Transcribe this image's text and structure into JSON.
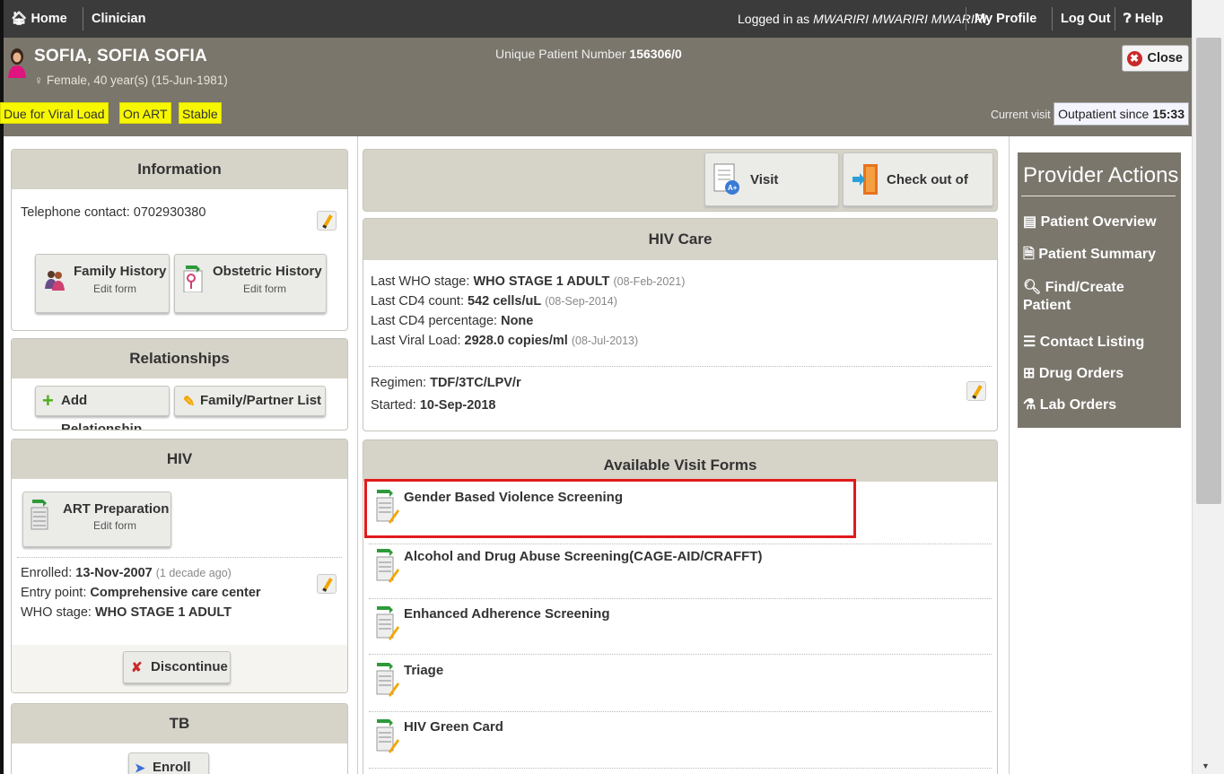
{
  "nav": {
    "home": "Home",
    "app": "Clinician",
    "logged_prefix": "Logged in as",
    "logged_user": "MWARIRI MWARIRI MWARIRI",
    "my_profile": "My Profile",
    "logout": "Log Out",
    "help": "Help"
  },
  "patient": {
    "name": "SOFIA, SOFIA SOFIA",
    "gender_age": "♀ Female, 40 year(s) (15-Jun-1981)",
    "upn_label": "Unique Patient Number",
    "upn": "156306/0",
    "flags": [
      "Due for Viral Load",
      "On ART",
      "Stable"
    ],
    "close": "Close",
    "current_visit_label": "Current visit",
    "visit_type": "Outpatient since",
    "visit_time": "15:33"
  },
  "information": {
    "title": "Information",
    "telephone": "Telephone contact: 0702930380",
    "family_history": "Family History",
    "family_history_sub": "Edit form",
    "obstetric_history": "Obstetric History",
    "obstetric_history_sub": "Edit form"
  },
  "relationships": {
    "title": "Relationships",
    "add": "Add Relationship",
    "list": "Family/Partner List"
  },
  "hiv": {
    "title": "HIV",
    "art_prep": "ART Preparation",
    "art_prep_sub": "Edit form",
    "enrolled_label": "Enrolled:",
    "enrolled": "13-Nov-2007",
    "enrolled_ago": "(1 decade ago)",
    "entry_label": "Entry point:",
    "entry": "Comprehensive care center",
    "who_label": "WHO stage:",
    "who": "WHO STAGE 1 ADULT",
    "discontinue": "Discontinue"
  },
  "tb": {
    "title": "TB",
    "enroll": "Enroll"
  },
  "toolbar": {
    "visit_summary": "Visit Summary",
    "check_out": "Check out of visit"
  },
  "hiv_care": {
    "title": "HIV Care",
    "who_label": "Last WHO stage:",
    "who": "WHO STAGE 1 ADULT",
    "who_date": "(08-Feb-2021)",
    "cd4_label": "Last CD4 count:",
    "cd4": "542 cells/uL",
    "cd4_date": "(08-Sep-2014)",
    "cd4p_label": "Last CD4 percentage:",
    "cd4p": "None",
    "vl_label": "Last Viral Load:",
    "vl": "2928.0 copies/ml",
    "vl_date": "(08-Jul-2013)",
    "regimen_label": "Regimen:",
    "regimen": "TDF/3TC/LPV/r",
    "started_label": "Started:",
    "started": "10-Sep-2018"
  },
  "visit_forms": {
    "title": "Available Visit Forms",
    "forms": [
      "Gender Based Violence Screening",
      "Alcohol and Drug Abuse Screening(CAGE-AID/CRAFFT)",
      "Enhanced Adherence Screening",
      "Triage",
      "HIV Green Card"
    ]
  },
  "provider_actions": {
    "title": "Provider Actions",
    "items": [
      "Patient Overview",
      "Patient Summary",
      "Find/Create",
      "Patient",
      "Contact Listing",
      "Drug Orders",
      "Lab Orders"
    ]
  },
  "colors": {
    "header": "#7a766c",
    "nav": "#3b3b3b",
    "flag": "#f7f700",
    "highlight": "#e01b1b"
  }
}
